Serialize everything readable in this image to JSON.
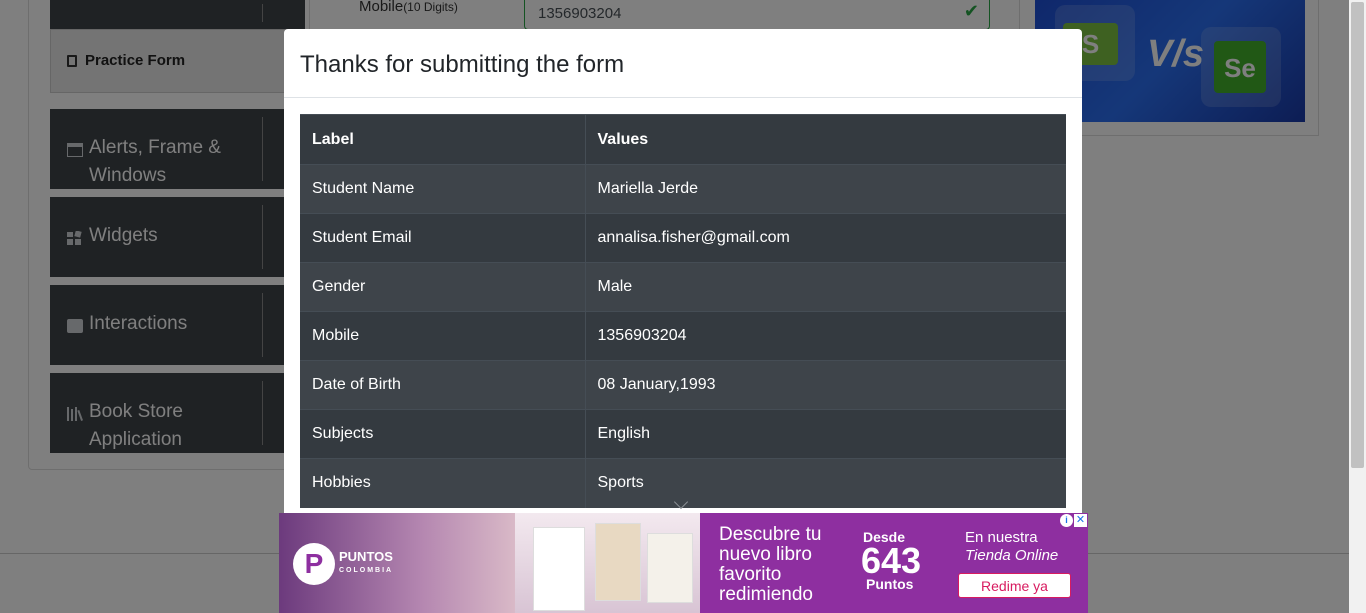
{
  "sidebar": {
    "active_item": "Practice Form",
    "groups": [
      {
        "label": "Alerts, Frame & Windows",
        "icon": "window-icon"
      },
      {
        "label": "Widgets",
        "icon": "widgets-icon"
      },
      {
        "label": "Interactions",
        "icon": "interactions-icon"
      },
      {
        "label": "Book Store Application",
        "icon": "bookstore-icon"
      }
    ]
  },
  "form": {
    "mobile_label": "Mobile",
    "mobile_hint": "(10 Digits)",
    "mobile_value": "1356903204"
  },
  "banner": {
    "left_logo": "S",
    "vs_text": "V/s",
    "right_logo": "Se"
  },
  "modal": {
    "title": "Thanks for submitting the form",
    "table": {
      "headers": [
        "Label",
        "Values"
      ],
      "rows": [
        [
          "Student Name",
          "Mariella Jerde"
        ],
        [
          "Student Email",
          "annalisa.fisher@gmail.com"
        ],
        [
          "Gender",
          "Male"
        ],
        [
          "Mobile",
          "1356903204"
        ],
        [
          "Date of Birth",
          "08 January,1993"
        ],
        [
          "Subjects",
          "English"
        ],
        [
          "Hobbies",
          "Sports"
        ]
      ]
    }
  },
  "ad": {
    "logo_letter": "P",
    "brand": "PUNTOS",
    "brand_sub": "COLOMBIA",
    "headline": "Descubre tu nuevo libro favorito redimiendo",
    "desde": "Desde",
    "points_value": "643",
    "points_label": "Puntos",
    "store_line1": "En nuestra",
    "store_line2": "Tienda Online",
    "button": "Redime ya",
    "info_glyph": "i",
    "close_glyph": "✕"
  },
  "colors": {
    "sidebar_group_bg": "#3e4449",
    "table_dark": "#343a40",
    "table_stripe": "#3e444a",
    "valid_green": "#28a745",
    "ad_purple": "#8e2fa0"
  }
}
